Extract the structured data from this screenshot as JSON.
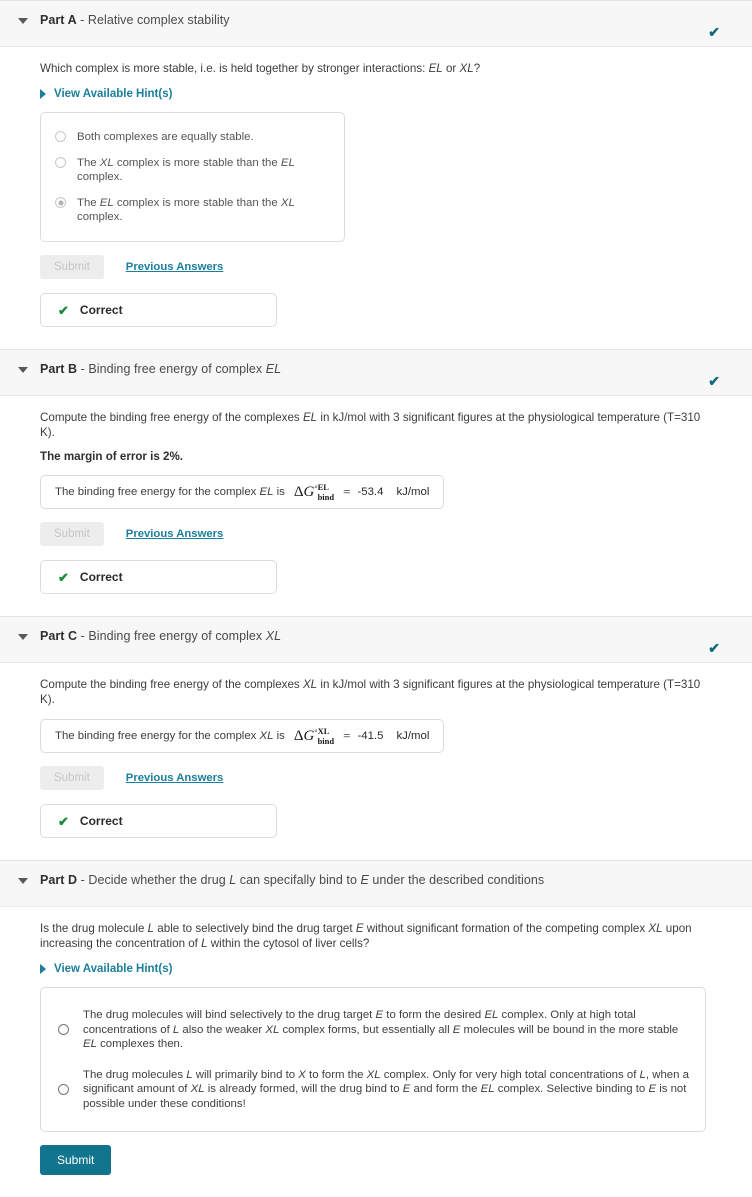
{
  "common": {
    "submit_label": "Submit",
    "previous_answers_label": "Previous Answers",
    "hint_label": "View Available Hint(s)",
    "correct_label": "Correct",
    "check_glyph": "✔",
    "units_kjmol": "kJ/mol",
    "equals": "=",
    "accent_color": "#11758f",
    "link_color": "#1b7e9c",
    "correct_color": "#1a8a3b",
    "header_check_color": "#14687f"
  },
  "parts": [
    {
      "id": "part-a",
      "label": "Part A",
      "separator": " - ",
      "title": "Relative complex stability",
      "status_check": "✔",
      "question": "Which complex is more stable, i.e. is held together by stronger interactions: EL or XL?",
      "has_hint": true,
      "choices": [
        {
          "text": "Both complexes are equally stable.",
          "checked": false,
          "enabled": false
        },
        {
          "text": "The XL complex is more stable than the EL complex.",
          "checked": false,
          "enabled": false
        },
        {
          "text": "The EL complex is more stable than the XL complex.",
          "checked": true,
          "enabled": false
        }
      ],
      "submit_disabled": true,
      "show_previous_answers": true,
      "correct": true
    },
    {
      "id": "part-b",
      "label": "Part B",
      "separator": " - ",
      "title": "Binding free energy of complex EL",
      "status_check": "✔",
      "question": "Compute the binding free energy of the complexes EL in kJ/mol with 3 significant figures at the physiological temperature (T=310 K).",
      "margin_note": "The margin of error is 2%.",
      "has_hint": false,
      "answer": {
        "prefix": "The binding free energy for the complex EL is",
        "symbol_delta": "Δ",
        "symbol_g": "G",
        "symbol_degree": "°",
        "superscript": "EL",
        "subscript": "bind",
        "equals": "=",
        "value": "-53.4",
        "units": "kJ/mol"
      },
      "submit_disabled": true,
      "show_previous_answers": true,
      "correct": true
    },
    {
      "id": "part-c",
      "label": "Part C",
      "separator": " - ",
      "title": "Binding free energy of complex XL",
      "status_check": "✔",
      "question": "Compute the binding free energy of the complexes XL in kJ/mol with 3 significant figures at the physiological temperature (T=310 K).",
      "has_hint": false,
      "answer": {
        "prefix": "The binding free energy for the complex XL is",
        "symbol_delta": "Δ",
        "symbol_g": "G",
        "symbol_degree": "°",
        "superscript": "XL",
        "subscript": "bind",
        "equals": "=",
        "value": "-41.5",
        "units": "kJ/mol"
      },
      "submit_disabled": true,
      "show_previous_answers": true,
      "correct": true
    },
    {
      "id": "part-d",
      "label": "Part D",
      "separator": " - ",
      "title": "Decide whether the drug L can specifally bind to E under the described conditions",
      "status_check": "",
      "question": "Is the drug molecule L able to selectively bind the drug target E without significant formation of the competing complex XL upon increasing the concentration of L within the cytosol of liver cells?",
      "has_hint": true,
      "choices": [
        {
          "text": "The drug molecules will bind selectively to the drug target E to form the desired EL complex. Only at high total concentrations of L also the weaker XL complex forms, but essentially all E molecules will be bound in the more stable EL complexes then.",
          "checked": false,
          "enabled": true
        },
        {
          "text": "The drug molecules L will primarily bind to X to form the XL complex. Only for very high total concentrations of L, when a significant amount of XL is already formed, will the drug bind to E and form the EL complex. Selective binding to E is not possible under these conditions!",
          "checked": false,
          "enabled": true
        }
      ],
      "submit_disabled": false,
      "show_previous_answers": false,
      "correct": false
    }
  ]
}
